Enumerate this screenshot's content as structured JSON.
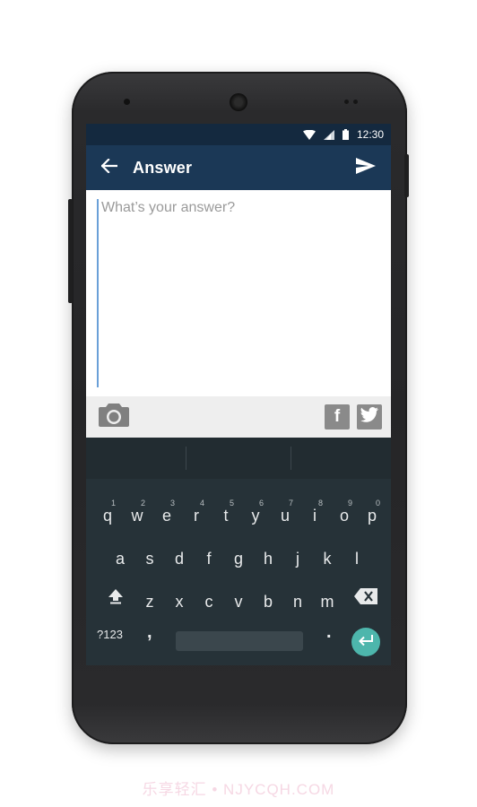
{
  "status": {
    "time": "12:30"
  },
  "appbar": {
    "title": "Answer",
    "back_icon": "arrow-back-icon",
    "send_icon": "send-icon"
  },
  "editor": {
    "placeholder": "What’s your answer?"
  },
  "media": {
    "camera_icon": "camera-icon",
    "share": [
      {
        "name": "facebook",
        "glyph": "f"
      },
      {
        "name": "twitter",
        "glyph": "twitter-bird-icon"
      }
    ]
  },
  "keyboard": {
    "row1": [
      {
        "key": "q",
        "hint": "1"
      },
      {
        "key": "w",
        "hint": "2"
      },
      {
        "key": "e",
        "hint": "3"
      },
      {
        "key": "r",
        "hint": "4"
      },
      {
        "key": "t",
        "hint": "5"
      },
      {
        "key": "y",
        "hint": "6"
      },
      {
        "key": "u",
        "hint": "7"
      },
      {
        "key": "i",
        "hint": "8"
      },
      {
        "key": "o",
        "hint": "9"
      },
      {
        "key": "p",
        "hint": "0"
      }
    ],
    "row2": [
      "a",
      "s",
      "d",
      "f",
      "g",
      "h",
      "j",
      "k",
      "l"
    ],
    "row3": [
      "z",
      "x",
      "c",
      "v",
      "b",
      "n",
      "m"
    ],
    "symbols_label": "?123",
    "comma": ",",
    "period": ".",
    "enter_color": "#4db6ac"
  },
  "colors": {
    "status_bar": "#14293f",
    "app_bar": "#1b3856",
    "keyboard_bg": "#263238"
  },
  "watermark": "乐享轻汇 • NJYCQH.COM"
}
